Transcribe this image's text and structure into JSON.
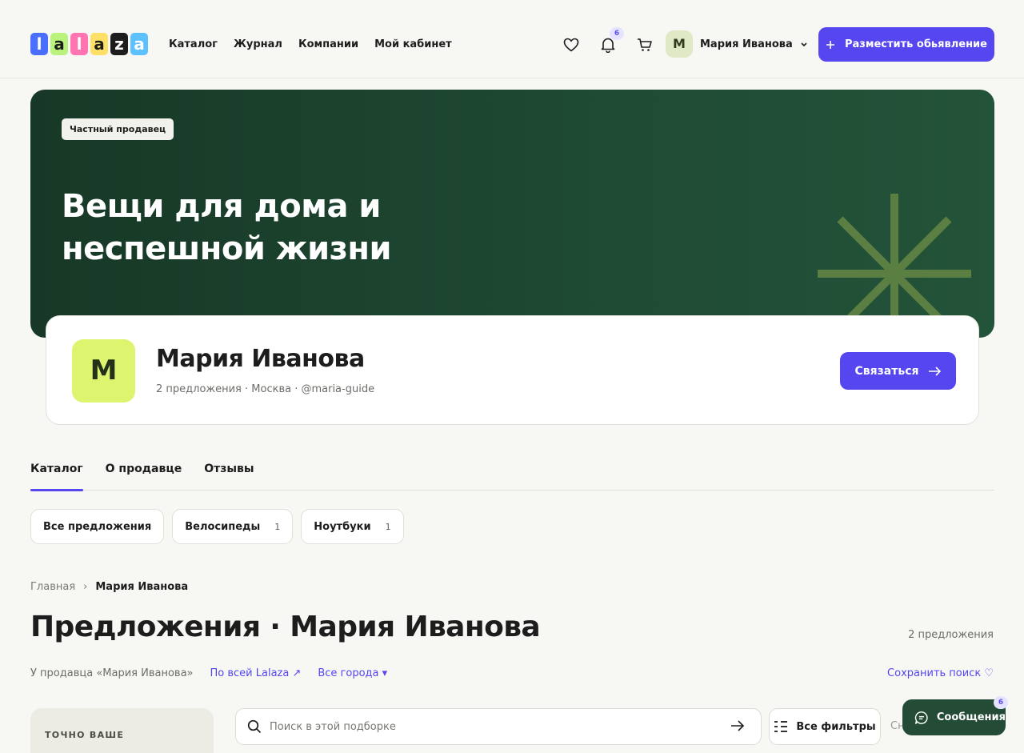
{
  "header": {
    "logo_letters": [
      "l",
      "a",
      "l",
      "a",
      "z",
      "a"
    ],
    "logo_colors": [
      "#4a6fff",
      "#b9f27c",
      "#ff74b1",
      "#ffe066",
      "#1d1d1d",
      "#5dc0ff"
    ],
    "nav": [
      "Каталог",
      "Журнал",
      "Компании",
      "Мой кабинет"
    ],
    "notifications_count": "6",
    "user_initial": "М",
    "user_name": "Мария Иванова",
    "post_button": "Разместить обьявление"
  },
  "banner": {
    "badge": "Частный продавец",
    "title": "Вещи для дома и неспешной жизни",
    "accent_color": "#5b7f43"
  },
  "profile": {
    "initial": "М",
    "name": "Мария Иванова",
    "meta": "2 предложения · Москва · @maria-guide",
    "contact_button": "Связаться"
  },
  "tabs": [
    "Каталог",
    "О продавце",
    "Отзывы"
  ],
  "chips": [
    {
      "label": "Все предложения",
      "count": ""
    },
    {
      "label": "Велосипеды",
      "count": "1"
    },
    {
      "label": "Ноутбуки",
      "count": "1"
    }
  ],
  "breadcrumb": {
    "home": "Главная",
    "current": "Мария Иванова"
  },
  "page_title": "Предложения · Мария Иванова",
  "offers_count": "2 предложения",
  "filters": {
    "scope": "У продавца «Мария Иванова»",
    "all_lalaza": "По всей Lalaza ↗",
    "cities": "Все города ▾",
    "save_search": "Сохранить поиск ♡"
  },
  "side": {
    "label": "ТОЧНО ВАШЕ"
  },
  "search": {
    "placeholder": "Поиск в этой подборке",
    "all_filters": "Все фильтры",
    "sort_peek": "Сн"
  },
  "messages": {
    "label": "Сообщения",
    "count": "6"
  }
}
